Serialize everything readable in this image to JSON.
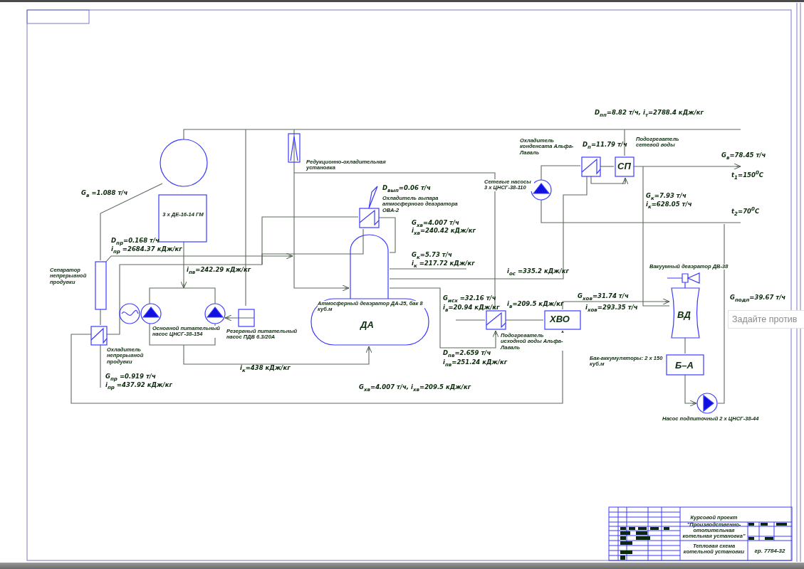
{
  "scheme": {
    "labels": [
      {
        "kind": "value",
        "text": "D$_{пп}$=8.82 т/ч, i$_{т}$=2788.4 кДж/кг"
      },
      {
        "kind": "value",
        "text": "G$_{в}$ =1.088 т/ч"
      },
      {
        "kind": "box",
        "text": "3 х ДЕ-16-14 ГМ"
      },
      {
        "kind": "value",
        "text": "D$_{пр}$=0.168 т/ч"
      },
      {
        "kind": "value",
        "text": "i$_{пр}$ =2684.37 кДж/кг"
      },
      {
        "kind": "note",
        "text": "Сепаратор непрерывной продувки"
      },
      {
        "kind": "value",
        "text": "i$_{пв}$=242.29 кДж/кг"
      },
      {
        "kind": "note",
        "text": "Редукционно-охладительная установка"
      },
      {
        "kind": "value",
        "text": "D$_{вып}$=0.06 т/ч"
      },
      {
        "kind": "note",
        "text": "Охладитель выпара атмосферного деаэратора ОВА-2"
      },
      {
        "kind": "value",
        "text": "G$_{хв}$=4.007 т/ч"
      },
      {
        "kind": "value",
        "text": "i$_{хв}$=240.42 кДж/кг"
      },
      {
        "kind": "value",
        "text": "G$_{к}$=5.73 т/ч"
      },
      {
        "kind": "value",
        "text": "i$_{к}$ =217.72 кДж/кг"
      },
      {
        "kind": "value",
        "text": "i$_{ос}$ =335.2 кДж/кг"
      },
      {
        "kind": "note",
        "text": "Атмосферный деаэратор ДА-25, бак 8 куб.м"
      },
      {
        "kind": "tag",
        "text": "ДА"
      },
      {
        "kind": "value",
        "text": "G$_{исх}$ =32.16 т/ч"
      },
      {
        "kind": "value",
        "text": "i$_{в}$=20.94 кДж/кг"
      },
      {
        "kind": "value",
        "text": "i$_{в}$=209.5 кДж/кг"
      },
      {
        "kind": "tag",
        "text": "ХВО"
      },
      {
        "kind": "note",
        "text": "Подогреватель исходной воды Альфа-Лаваль"
      },
      {
        "kind": "value",
        "text": "D$_{пв}$=2.659 т/ч"
      },
      {
        "kind": "value",
        "text": "i$_{пв}$=251.24 кДж/кг"
      },
      {
        "kind": "value",
        "text": "i$_{к}$=438 кДж/кг"
      },
      {
        "kind": "value",
        "text": "G$_{хв}$=4.007 т/ч, i$_{хв}$=209.5 кДж/кг"
      },
      {
        "kind": "note",
        "text": "Основной питательный насос ЦНСГ-38-154"
      },
      {
        "kind": "note",
        "text": "Резервный питательный насос ПДВ 6.3/20А"
      },
      {
        "kind": "note",
        "text": "Охладитель непрерывной продувки"
      },
      {
        "kind": "value",
        "text": "G$_{пр}$ =0.919 т/ч"
      },
      {
        "kind": "value",
        "text": "i$_{пр}$ =437.92 кДж/кг"
      },
      {
        "kind": "note",
        "text": "Сетевые насосы 3 х ЦНСГ-38-110"
      },
      {
        "kind": "note",
        "text": "Охладитель конденсата Альфа-Лаваль"
      },
      {
        "kind": "value",
        "text": "D$_{п}$=11.79 т/ч"
      },
      {
        "kind": "note",
        "text": "Подогреватель сетевой воды"
      },
      {
        "kind": "tag",
        "text": "СП"
      },
      {
        "kind": "value",
        "text": "G$_{в}$=78.45 т/ч"
      },
      {
        "kind": "value",
        "text": "t$_{1}$=150$^{0}$C"
      },
      {
        "kind": "value",
        "text": "G$_{к}$=7.93 т/ч"
      },
      {
        "kind": "value",
        "text": "i$_{к}$=628.05 т/ч"
      },
      {
        "kind": "value",
        "text": "t$_{2}$=70$^{0}$C"
      },
      {
        "kind": "note",
        "text": "Вакуумный деаэратор ДВ-38"
      },
      {
        "kind": "tag",
        "text": "ВД"
      },
      {
        "kind": "value",
        "text": "G$_{хов}$=31.74 т/ч"
      },
      {
        "kind": "value",
        "text": "i$_{хов}$=293.35 т/ч"
      },
      {
        "kind": "value",
        "text": "G$_{подп}$=39.67 т/ч"
      },
      {
        "kind": "note",
        "text": "Бак-аккумуляторы: 2 х 150 куб.м"
      },
      {
        "kind": "tag",
        "text": "Б–А"
      },
      {
        "kind": "note",
        "text": "Насос подпиточный 2 х ЦНСГ-38-44"
      }
    ]
  },
  "title_block": {
    "project": "Курсовой проект",
    "subject": "\"Производственно-отопительная котельная установка\"",
    "sheet": "Тепловая схема котельной установки",
    "group": "гр. 7784-32"
  },
  "tooltip": {
    "text": "Задайте против"
  }
}
